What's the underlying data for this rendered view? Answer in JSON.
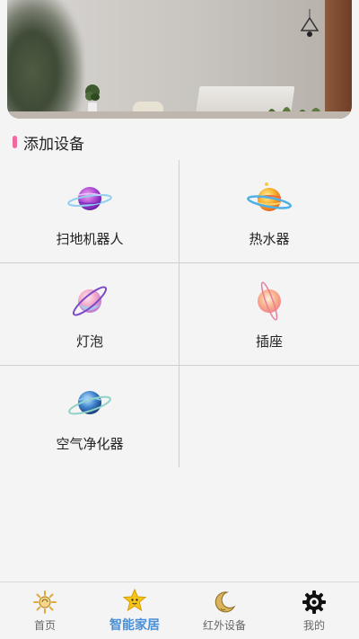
{
  "section": {
    "title": "添加设备"
  },
  "devices": [
    {
      "label": "扫地机器人",
      "icon": "purple-planet-icon"
    },
    {
      "label": "热水器",
      "icon": "orange-planet-icon"
    },
    {
      "label": "灯泡",
      "icon": "pink-planet-icon"
    },
    {
      "label": "插座",
      "icon": "peach-planet-icon"
    },
    {
      "label": "空气净化器",
      "icon": "blue-planet-icon"
    }
  ],
  "nav": {
    "items": [
      {
        "label": "首页",
        "icon": "sun-icon"
      },
      {
        "label": "智能家居",
        "icon": "star-icon"
      },
      {
        "label": "红外设备",
        "icon": "moon-icon"
      },
      {
        "label": "我的",
        "icon": "gear-icon"
      }
    ],
    "active_index": 1
  },
  "colors": {
    "accent": "#4a8fd6",
    "title_bar": "#f06aa0",
    "background": "#f4f4f4"
  }
}
